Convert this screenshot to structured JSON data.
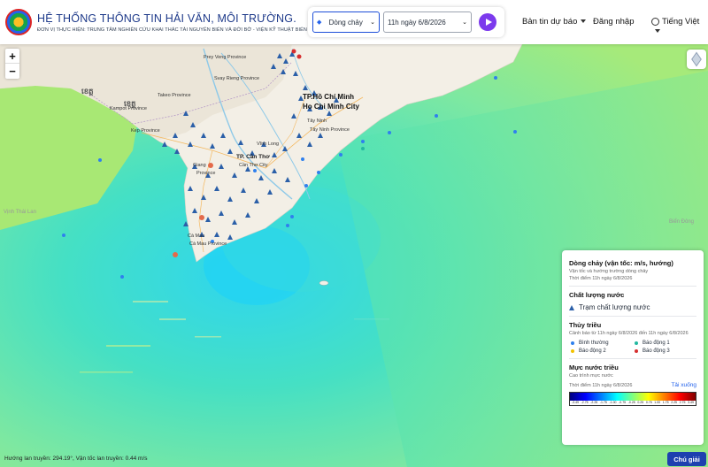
{
  "header": {
    "title": "HỆ THỐNG THÔNG TIN HẢI VĂN, MÔI TRƯỜNG.",
    "subtitle": "ĐƠN VỊ THỰC HIỆN: TRUNG TÂM NGHIÊN CỨU KHAI THÁC TÀI NGUYÊN BIỂN VÀ ĐỚI BỜ - VIỆN KỸ THUẬT BIỂN",
    "layer_select": "Dòng chảy",
    "time_select": "11h ngày 6/8/2026",
    "nav_bulletin": "Bản tin dự báo",
    "nav_login": "Đăng nhập",
    "nav_language": "Tiếng Việt"
  },
  "map": {
    "zoom_in": "+",
    "zoom_out": "−",
    "labels": {
      "prey_veng": "Prey Veng Province",
      "svay_rieng": "Svay Rieng Province",
      "takeo": "Takeo Province",
      "kampot": "Kampot Province",
      "kep": "Kep Province",
      "hcm": "TP.Hồ Chí Minh",
      "hcm2": "Ho Chi Minh City",
      "tay_ninh": "Tây Ninh",
      "tay_ninh_p": "Tây Ninh Province",
      "vinh_long": "Vĩnh Long",
      "can_tho": "TP. Cần Thơ",
      "can_tho2": "Cần Thơ City",
      "an_giang": "Giang",
      "an_giang2": "Province",
      "ca_mau": "Cà Mau",
      "ca_mau2": "Cà Mau Province",
      "gulf_left": "Vịnh Thái Lan",
      "east_sea": "Biển Đông"
    }
  },
  "legend": {
    "flow_title": "Dòng chảy (vận tốc: m/s, hướng)",
    "flow_sub": "Vận tốc và hướng trường dòng chảy",
    "flow_time": "Thời điểm 11h ngày 6/8/2026",
    "water_title": "Chất lượng nước",
    "water_station": "Trạm chất lượng nước",
    "tide_title": "Thủy triều",
    "tide_sub": "Cảnh báo từ 11h ngày 6/8/2026 đến 11h ngày 6/8/2026",
    "tide_levels": [
      {
        "label": "Bình thường",
        "color": "#2f80ed"
      },
      {
        "label": "Báo động 1",
        "color": "#22b8a0"
      },
      {
        "label": "Báo động 2",
        "color": "#f2c200"
      },
      {
        "label": "Báo động 3",
        "color": "#d62f2f"
      }
    ],
    "level_title": "Mực nước triều",
    "level_sub": "Cao trình mực nước",
    "level_time": "Thời điểm 11h ngày 6/8/2026",
    "download": "Tải xuống",
    "colorbar_ticks": [
      "-3.49",
      "-2.75",
      "-2.25",
      "-1.75",
      "-1.00",
      "-0.75",
      "-0.25",
      "0.25",
      "0.75",
      "1.00",
      "1.75",
      "2.25",
      "2.75",
      "3.49"
    ]
  },
  "status": {
    "text": "Hướng lan truyền: 294.19°, Vận tốc lan truyền: 0.44 m/s"
  },
  "help_label": "Chú giải"
}
